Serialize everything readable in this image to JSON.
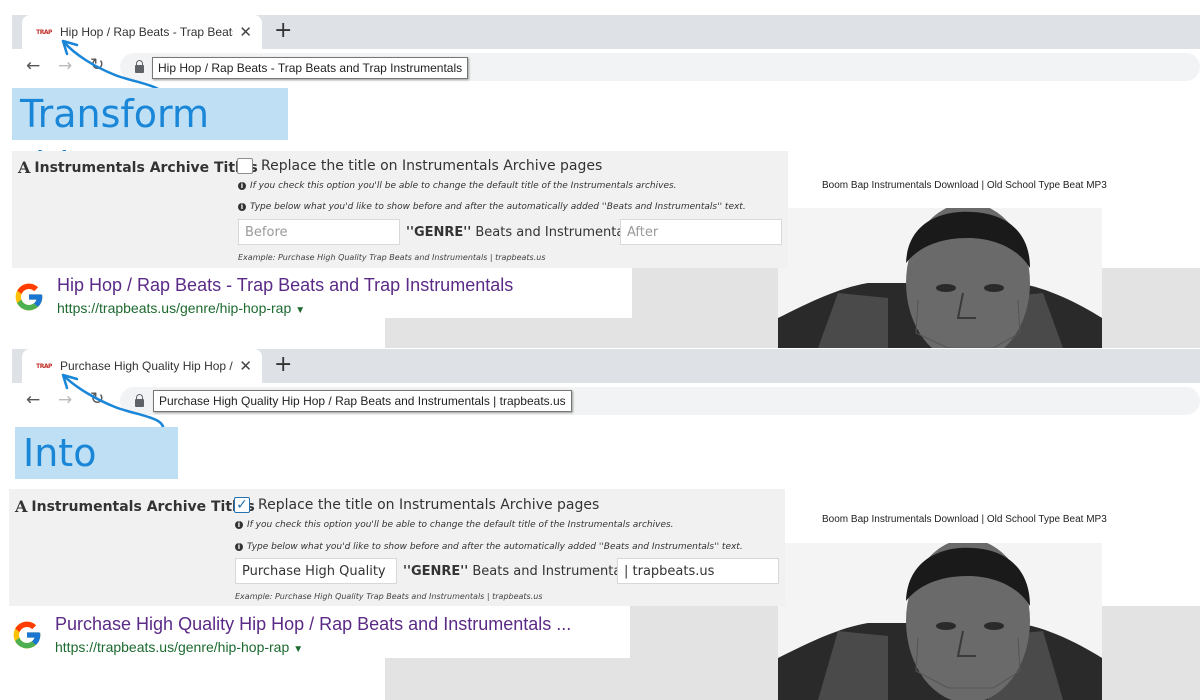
{
  "before": {
    "tab_title": "Hip Hop / Rap Beats - Trap Beats",
    "tooltip": "Hip Hop / Rap Beats - Trap Beats and Trap Instrumentals",
    "banner": "Transform this",
    "settings": {
      "heading": "Instrumentals Archive Titles",
      "checkbox_label": "Replace the title on Instrumentals Archive pages",
      "checked": false,
      "note1": "If you check this option you'll be able to change the default title of the Instrumentals archives.",
      "note2": "Type below what you'd like to show before and after the automatically added ''Beats and Instrumentals'' text.",
      "before_value": "",
      "before_placeholder": "Before",
      "genre_label": "''GENRE''",
      "middle_text": "Beats and Instrumentals",
      "after_value": "",
      "after_placeholder": "After",
      "example": "Example: Purchase High Quality Trap Beats and Instrumentals | trapbeats.us"
    },
    "google": {
      "title": "Hip Hop / Rap Beats - Trap Beats and Trap Instrumentals",
      "url": "https://trapbeats.us/genre/hip-hop-rap"
    },
    "page_caption": "Boom Bap Instrumentals Download | Old School Type Beat MP3"
  },
  "after": {
    "tab_title": "Purchase High Quality Hip Hop /",
    "tooltip": "Purchase High Quality Hip Hop / Rap Beats and Instrumentals | trapbeats.us",
    "banner": "Into this",
    "settings": {
      "heading": "Instrumentals Archive Titles",
      "checkbox_label": "Replace the title on Instrumentals Archive pages",
      "checked": true,
      "note1": "If you check this option you'll be able to change the default title of the Instrumentals archives.",
      "note2": "Type below what you'd like to show before and after the automatically added ''Beats and Instrumentals'' text.",
      "before_value": "Purchase High Quality",
      "genre_label": "''GENRE''",
      "middle_text": "Beats and Instrumentals",
      "after_value": "| trapbeats.us",
      "example": "Example: Purchase High Quality Trap Beats and Instrumentals | trapbeats.us"
    },
    "google": {
      "title": "Purchase High Quality Hip Hop / Rap Beats and Instrumentals ...",
      "url": "https://trapbeats.us/genre/hip-hop-rap"
    },
    "page_caption": "Boom Bap Instrumentals Download | Old School Type Beat MP3"
  },
  "browser": {
    "favicon_text": "TRAP",
    "new_tab": "+",
    "close": "✕"
  },
  "colors": {
    "banner_bg": "#bfe0f4",
    "banner_text": "#1a86d8",
    "arrow": "#1a86d8",
    "google_title": "#5b2a86",
    "google_url": "#1c6a2f"
  },
  "icons": [
    "favicon-icon",
    "close-icon",
    "new-tab-icon",
    "back-icon",
    "forward-icon",
    "reload-icon",
    "lock-icon",
    "info-icon",
    "font-icon",
    "google-logo-icon",
    "arrow-icon"
  ]
}
